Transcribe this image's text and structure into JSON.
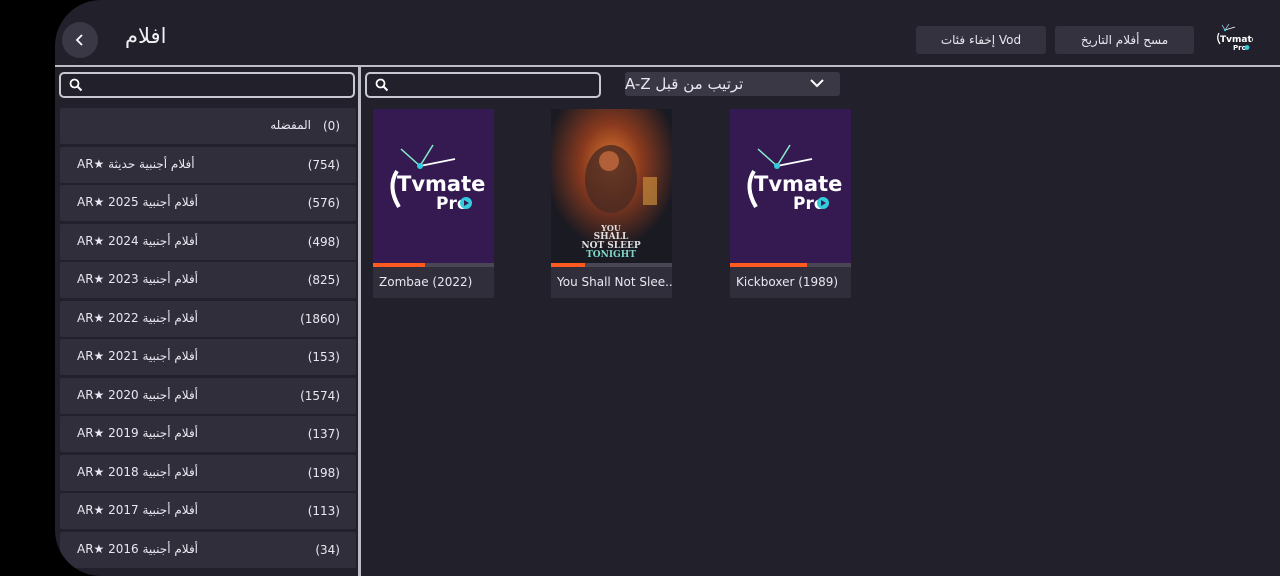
{
  "header": {
    "title": "افلام",
    "hide_vod_label": "إخفاء فئات Vod",
    "clear_history_label": "مسح أفلام التاريخ",
    "logo_name": "tvmate-pro-logo"
  },
  "sort": {
    "label": "ترتيب من قبل A-Z"
  },
  "categories": [
    {
      "name": "المفضله",
      "count": "(0)"
    },
    {
      "name": "أفلام أجنبية حديثة ★AR",
      "count": "(754)"
    },
    {
      "name": "أفلام أجنبية 2025 ★AR",
      "count": "(576)"
    },
    {
      "name": "أفلام أجنبية 2024 ★AR",
      "count": "(498)"
    },
    {
      "name": "أفلام أجنبية 2023 ★AR",
      "count": "(825)"
    },
    {
      "name": "أفلام أجنبية 2022 ★AR",
      "count": "(1860)"
    },
    {
      "name": "أفلام أجنبية 2021 ★AR",
      "count": "(153)"
    },
    {
      "name": "أفلام أجنبية 2020 ★AR",
      "count": "(1574)"
    },
    {
      "name": "أفلام أجنبية 2019 ★AR",
      "count": "(137)"
    },
    {
      "name": "أفلام أجنبية 2018 ★AR",
      "count": "(198)"
    },
    {
      "name": "أفلام أجنبية 2017 ★AR",
      "count": "(113)"
    },
    {
      "name": "أفلام أجنبية 2016 ★AR",
      "count": "(34)"
    }
  ],
  "movies": [
    {
      "title": "Zombae (2022)",
      "progress": 0.43,
      "poster": "tvmate-pro-placeholder"
    },
    {
      "title": "You Shall Not Slee..",
      "progress": 0.28,
      "poster": "you-shall-not-sleep-tonight-poster",
      "poster_text": [
        "YOU",
        "SHALL",
        "NOT SLEEP",
        "TONIGHT"
      ]
    },
    {
      "title": "Kickboxer (1989)",
      "progress": 0.64,
      "poster": "tvmate-pro-placeholder"
    }
  ],
  "colors": {
    "accent": "#ff5a1f",
    "background": "#22202b",
    "item": "#302e3b"
  }
}
